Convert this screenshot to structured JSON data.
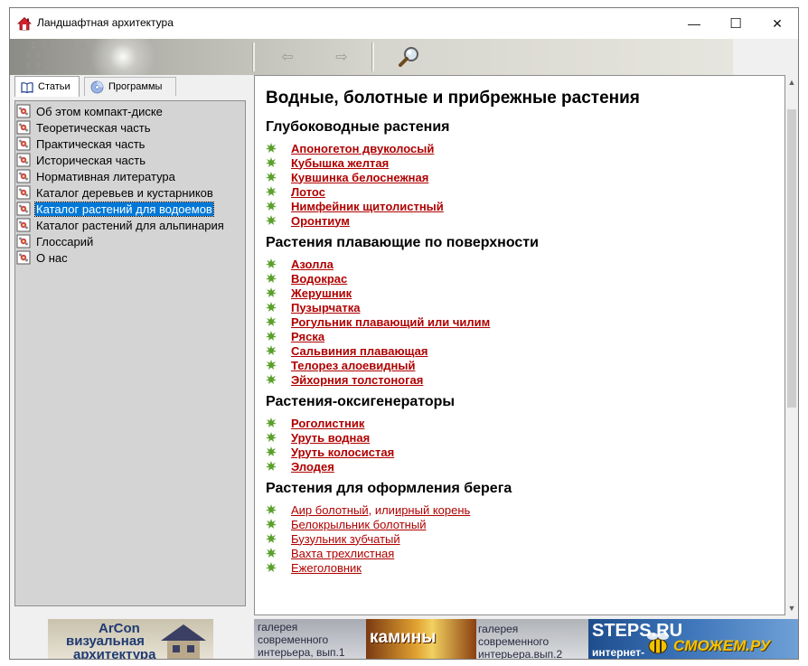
{
  "window": {
    "title": "Ландшафтная архитектура",
    "app_icon": "house-icon",
    "minimize_glyph": "—",
    "maximize_glyph": "☐",
    "close_glyph": "✕"
  },
  "toolbar": {
    "icons": [
      "back-arrow-icon",
      "forward-arrow-icon",
      "search-icon"
    ],
    "back_glyph": "⇦",
    "forward_glyph": "⇨",
    "decor_glyphs": " Σ ∇ ≡ √ ♦ Λ\n∨ ∆ ⊙ Ψ ≥ ∗\n∧ ⊕ ⊇ ∞ ∆\n≈ Ω ÷ ∂ ⊗ ⋅"
  },
  "tabs": [
    {
      "label": "Статьи",
      "icon": "book-icon",
      "active": true
    },
    {
      "label": "Программы",
      "icon": "cd-disc-icon",
      "active": false
    }
  ],
  "tree": {
    "items": [
      {
        "label": "Об этом компакт-диске",
        "selected": false
      },
      {
        "label": "Теоретическая часть",
        "selected": false
      },
      {
        "label": "Практическая часть",
        "selected": false
      },
      {
        "label": "Историческая часть",
        "selected": false
      },
      {
        "label": "Нормативная литература",
        "selected": false
      },
      {
        "label": "Каталог деревьев и кустарников",
        "selected": false
      },
      {
        "label": "Каталог растений для водоемов",
        "selected": true
      },
      {
        "label": "Каталог растений для альпинария",
        "selected": false
      },
      {
        "label": "Глоссарий",
        "selected": false
      },
      {
        "label": "О нас",
        "selected": false
      }
    ]
  },
  "content": {
    "title": "Водные, болотные и прибрежные растения",
    "sections": [
      {
        "title": "Глубоководные растения",
        "plants": [
          "Апоногетон двуколосый",
          "Кубышка желтая",
          "Кувшинка белоснежная",
          "Лотос",
          "Нимфейник щитолистный",
          "Оронтиум"
        ]
      },
      {
        "title": "Растения плавающие по поверхности",
        "plants": [
          "Азолла",
          "Водокрас",
          "Жерушник",
          "Пузырчатка",
          "Рогульник плавающий или чилим",
          "Ряска",
          "Сальвиния плавающая",
          "Телорез алоевидный",
          "Эйхорния толстоногая"
        ]
      },
      {
        "title": "Растения-оксигенераторы",
        "plants": [
          "Роголистник",
          "Уруть водная",
          "Уруть колосистая",
          "Элодея"
        ]
      },
      {
        "title": "Растения для оформления берега",
        "plants": [
          "Аир болотный",
          "Белокрыльник болотный",
          "Бузульник зубчатый",
          "Вахта трехлистная",
          "Ежеголовник"
        ],
        "first_extra": {
          "sep": ", или ",
          "label": "ирный корень"
        }
      }
    ]
  },
  "banners": {
    "arcon_line1": "ArCon",
    "arcon_line2": "визуальная",
    "arcon_line3": "архитектура",
    "gallery1_line1": "галерея",
    "gallery1_line2": "современного",
    "gallery1_line3": "интерьера, вып.1",
    "fireplaces": "камины",
    "gallery2_line1": "галерея",
    "gallery2_line2": "современного",
    "gallery2_line3": "интерьера.вып.2",
    "steps_line1": "STEPS.RU",
    "steps_line2": "интернет-",
    "watermark": "СМОЖЕМ.РУ"
  },
  "colors": {
    "link": "#b00000",
    "selection": "#0078d7",
    "tree_bg": "#d4d4d4",
    "bullet": "#5aa02c"
  }
}
